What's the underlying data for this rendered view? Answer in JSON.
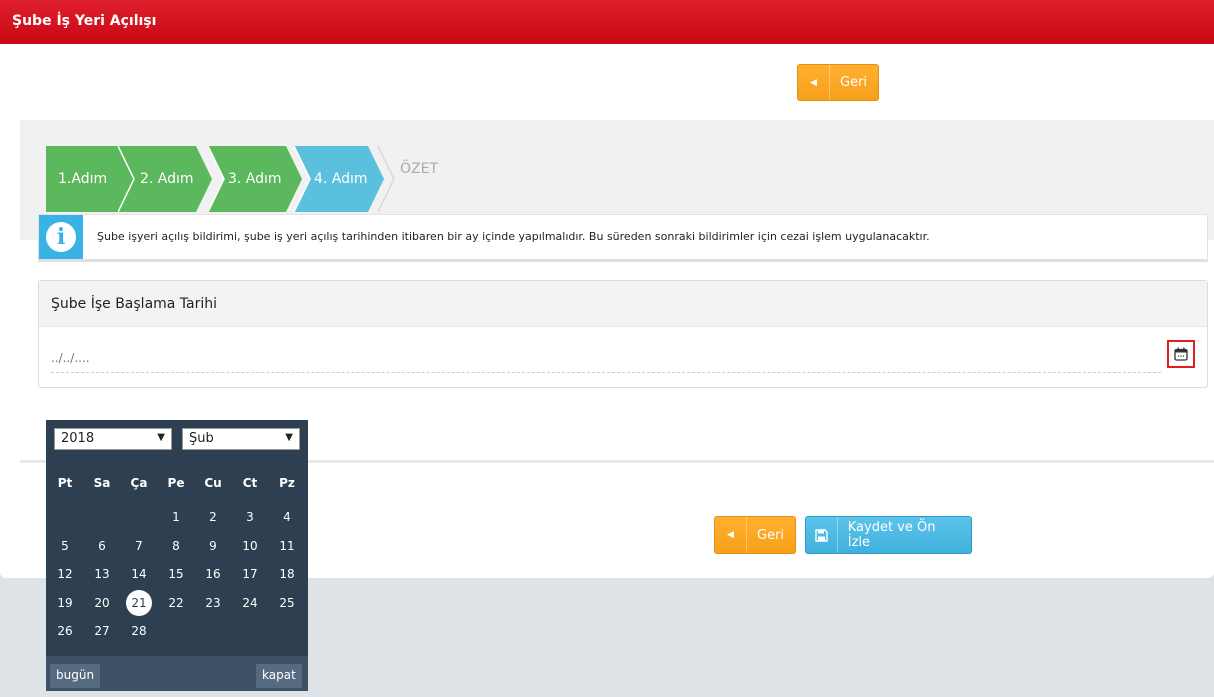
{
  "header": {
    "title": "Şube İş Yeri Açılışı"
  },
  "top_back_button": {
    "label": "Geri"
  },
  "steps": [
    {
      "label": "1.Adım",
      "color": "#5cb85c"
    },
    {
      "label": "2. Adım",
      "color": "#5cb85c"
    },
    {
      "label": "3. Adım",
      "color": "#5cb85c"
    },
    {
      "label": "4. Adım",
      "color": "#5bc0de"
    }
  ],
  "summary_step": {
    "label": "ÖZET"
  },
  "info": {
    "text": "Şube işyeri açılış bildirimi, şube iş yeri açılış tarihinden itibaren bir ay içinde yapılmalıdır. Bu süreden sonraki bildirimler için cezai işlem uygulanacaktır."
  },
  "start_date": {
    "label": "Şube İşe Başlama Tarihi",
    "placeholder": "../../...."
  },
  "datepicker": {
    "year": "2018",
    "month": "Şub",
    "weekdays": [
      "Pt",
      "Sa",
      "Ça",
      "Pe",
      "Cu",
      "Ct",
      "Pz"
    ],
    "weeks": [
      [
        "",
        "",
        "",
        "1",
        "2",
        "3",
        "4"
      ],
      [
        "5",
        "6",
        "7",
        "8",
        "9",
        "10",
        "11"
      ],
      [
        "12",
        "13",
        "14",
        "15",
        "16",
        "17",
        "18"
      ],
      [
        "19",
        "20",
        "21",
        "22",
        "23",
        "24",
        "25"
      ],
      [
        "26",
        "27",
        "28",
        "",
        "",
        "",
        ""
      ]
    ],
    "today": "21",
    "today_button": "bugün",
    "close_button": "kapat"
  },
  "footer": {
    "back_label": "Geri",
    "save_label": "Kaydet ve Ön İzle"
  }
}
